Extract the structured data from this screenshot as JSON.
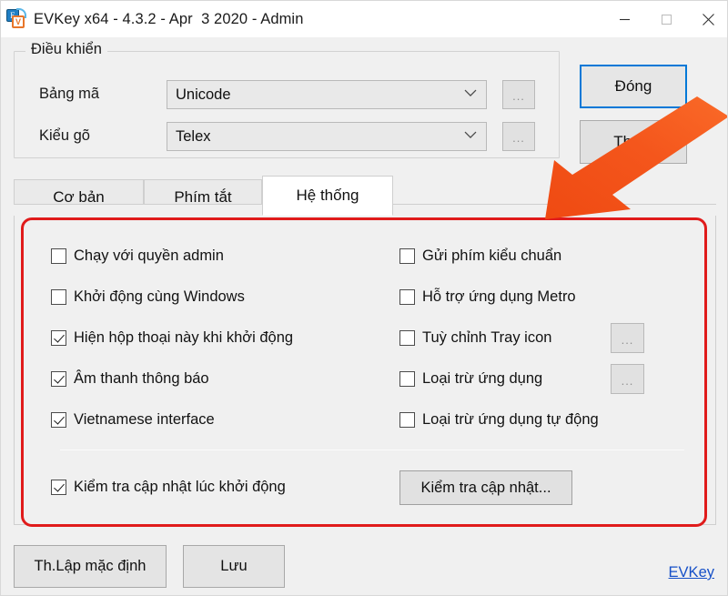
{
  "window": {
    "title": "EVKey x64 - 4.3.2 - Apr  3 2020 - Admin",
    "icon": "evkey-app-icon",
    "minimize_label": "minimize-icon",
    "maximize_label": "maximize-icon",
    "close_label": "close-icon"
  },
  "control_group": {
    "title": "Điều khiển",
    "fields": [
      {
        "label": "Bảng mã",
        "value": "Unicode",
        "more_label": "..."
      },
      {
        "label": "Kiểu gõ",
        "value": "Telex",
        "more_label": "..."
      }
    ]
  },
  "actions": {
    "close_label": "Đóng",
    "exit_label": "Thoát"
  },
  "tabs": [
    {
      "label": "Cơ bản",
      "active": false
    },
    {
      "label": "Phím tắt",
      "active": false
    },
    {
      "label": "Hệ thống",
      "active": true
    }
  ],
  "system_tab": {
    "left_options": [
      {
        "label": "Chạy với quyền admin",
        "checked": false
      },
      {
        "label": "Khởi động cùng Windows",
        "checked": false
      },
      {
        "label": "Hiện hộp thoại này khi khởi động",
        "checked": true
      },
      {
        "label": "Âm thanh thông báo",
        "checked": true
      },
      {
        "label": "Vietnamese interface",
        "checked": true
      }
    ],
    "right_options": [
      {
        "label": "Gửi phím kiểu chuẩn",
        "checked": false,
        "more_label": null
      },
      {
        "label": "Hỗ trợ ứng dụng Metro",
        "checked": false,
        "more_label": null
      },
      {
        "label": "Tuỳ chỉnh Tray icon",
        "checked": false,
        "more_label": "..."
      },
      {
        "label": "Loại trừ ứng dụng",
        "checked": false,
        "more_label": "..."
      },
      {
        "label": "Loại trừ ứng dụng tự động",
        "checked": false,
        "more_label": null
      }
    ],
    "update_option": {
      "label": "Kiểm tra cập nhật lúc khởi động",
      "checked": true
    },
    "update_button_label": "Kiểm tra cập nhật..."
  },
  "footer": {
    "defaults_label": "Th.Lập mặc định",
    "save_label": "Lưu",
    "link_label": "EVKey"
  },
  "annotations": {
    "highlight_color": "#e01b1b",
    "arrow_color": "#f0490f",
    "accent_color": "#0078d7",
    "link_color": "#1650c8"
  }
}
